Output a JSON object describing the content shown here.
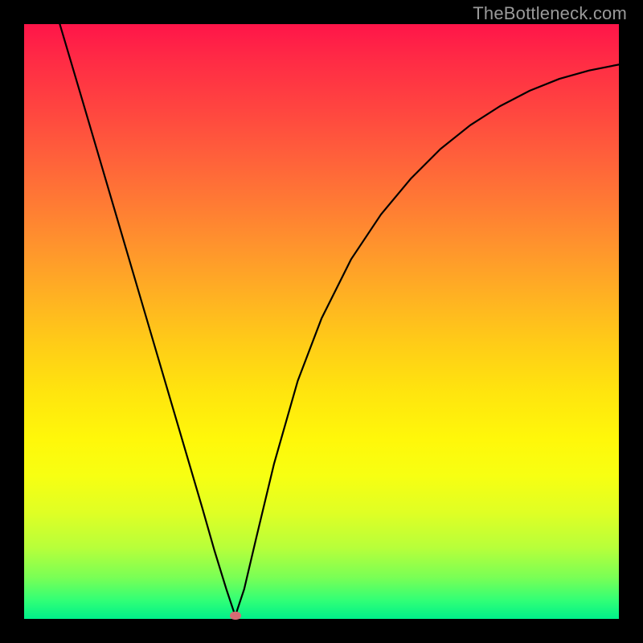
{
  "watermark": "TheBottleneck.com",
  "colors": {
    "frame": "#000000",
    "curve": "#000000",
    "marker": "#d86b74",
    "watermark": "#9a9a9a",
    "gradient_top": "#ff1549",
    "gradient_bottom": "#00f08a"
  },
  "chart_data": {
    "type": "line",
    "title": "",
    "xlabel": "",
    "ylabel": "",
    "xlim": [
      0,
      1
    ],
    "ylim": [
      0,
      1
    ],
    "series": [
      {
        "name": "curve",
        "x": [
          0.06,
          0.1,
          0.15,
          0.2,
          0.25,
          0.275,
          0.3,
          0.32,
          0.34,
          0.355,
          0.37,
          0.39,
          0.42,
          0.46,
          0.5,
          0.55,
          0.6,
          0.65,
          0.7,
          0.75,
          0.8,
          0.85,
          0.9,
          0.95,
          1.0
        ],
        "y": [
          1.0,
          0.865,
          0.695,
          0.525,
          0.355,
          0.27,
          0.185,
          0.115,
          0.05,
          0.005,
          0.05,
          0.135,
          0.26,
          0.4,
          0.505,
          0.605,
          0.68,
          0.74,
          0.79,
          0.83,
          0.862,
          0.888,
          0.908,
          0.922,
          0.932
        ]
      }
    ],
    "marker": {
      "x": 0.355,
      "y": 0.005
    },
    "annotations": []
  }
}
